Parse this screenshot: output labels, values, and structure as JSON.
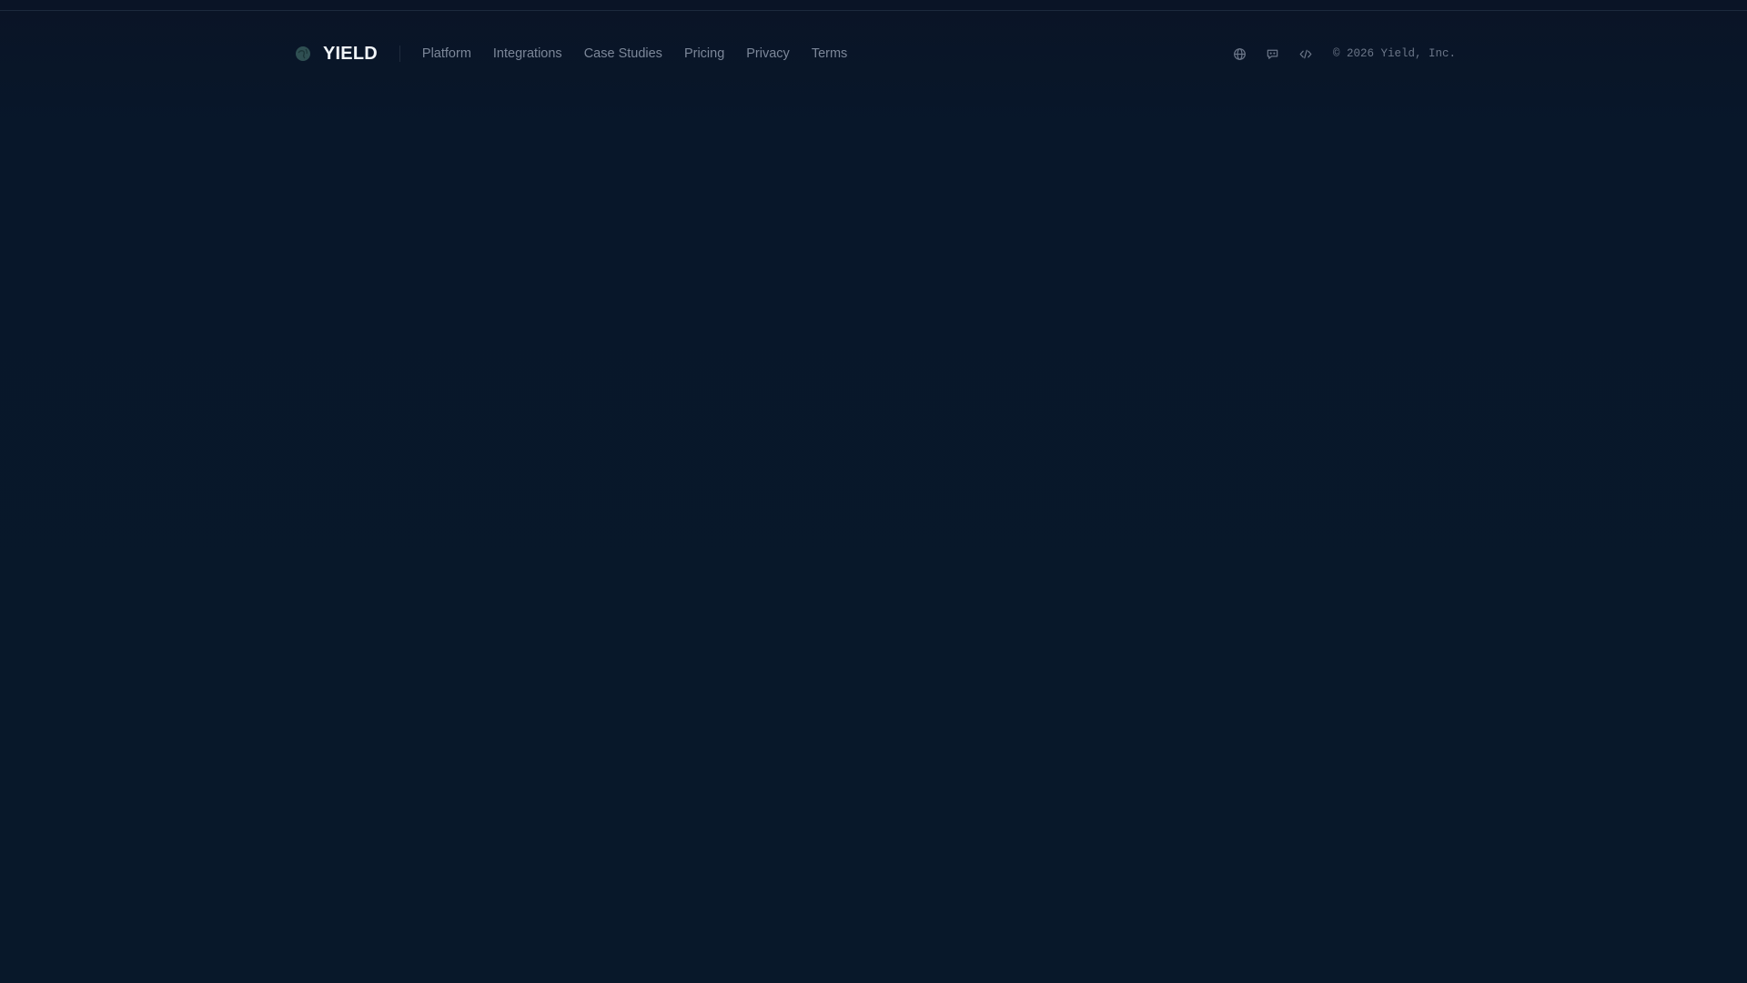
{
  "brand": {
    "name": "YIELD",
    "logo_icon": "globe-leaf-icon",
    "logo_color": "#2f4f52"
  },
  "nav": {
    "items": [
      {
        "label": "Platform"
      },
      {
        "label": "Integrations"
      },
      {
        "label": "Case Studies"
      },
      {
        "label": "Pricing"
      },
      {
        "label": "Privacy"
      },
      {
        "label": "Terms"
      }
    ]
  },
  "social": {
    "icons": [
      "globe-icon",
      "chat-icon",
      "code-icon"
    ],
    "icon_color": "#6b7688"
  },
  "footer": {
    "copyright": "© 2026 Yield, Inc."
  },
  "colors": {
    "background": "#08172a",
    "brand_text": "#f1f5f9",
    "nav_text": "#7c8799"
  }
}
